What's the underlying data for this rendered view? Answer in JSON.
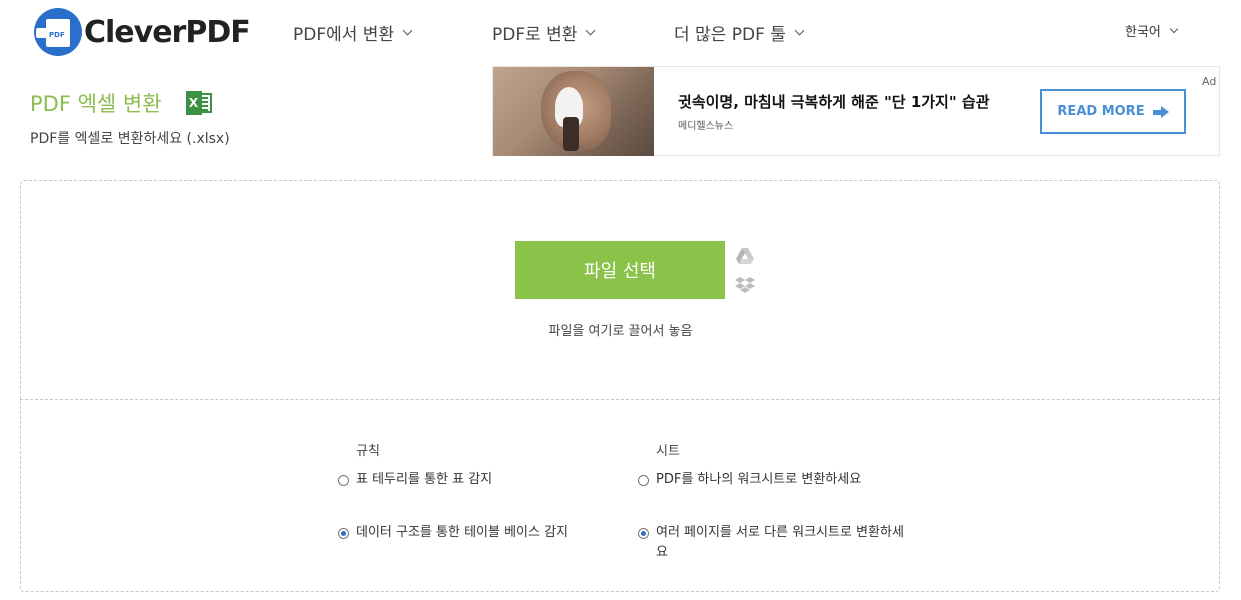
{
  "header": {
    "logo_text": "CleverPDF",
    "logo_badge": "PDF",
    "nav": [
      {
        "label": "PDF에서 변환"
      },
      {
        "label": "PDF로 변환"
      },
      {
        "label": "더 많은 PDF 툴"
      }
    ],
    "language": "한국어"
  },
  "page": {
    "title": "PDF 엑셀 변환",
    "subtitle": "PDF를 엑셀로 변환하세요 (.xlsx)",
    "excel_icon_letter": "X"
  },
  "ad": {
    "headline": "귓속이명, 마침내 극복하게 해준 \"단 1가지\" 습관",
    "source": "메디헬스뉴스",
    "button_label": "READ MORE",
    "label": "Ad"
  },
  "upload": {
    "choose_button": "파일 선택",
    "drop_hint": "파일을 여기로 끌어서 놓음",
    "icons": [
      "google-drive-icon",
      "dropbox-icon"
    ]
  },
  "options": {
    "rules": {
      "heading": "규칙",
      "items": [
        {
          "label": "표 테두리를 통한 표 감지",
          "selected": false
        },
        {
          "label": "데이터 구조를 통한 테이블 베이스 감지",
          "selected": true
        }
      ]
    },
    "sheets": {
      "heading": "시트",
      "items": [
        {
          "label": "PDF를 하나의 워크시트로 변환하세요",
          "selected": false
        },
        {
          "label": "여러 페이지를 서로 다른 워크시트로 변환하세요",
          "selected": true
        }
      ]
    }
  },
  "colors": {
    "brand_blue": "#2a6fc9",
    "accent_green": "#8bc34a",
    "ad_button_blue": "#4a8fd6"
  }
}
